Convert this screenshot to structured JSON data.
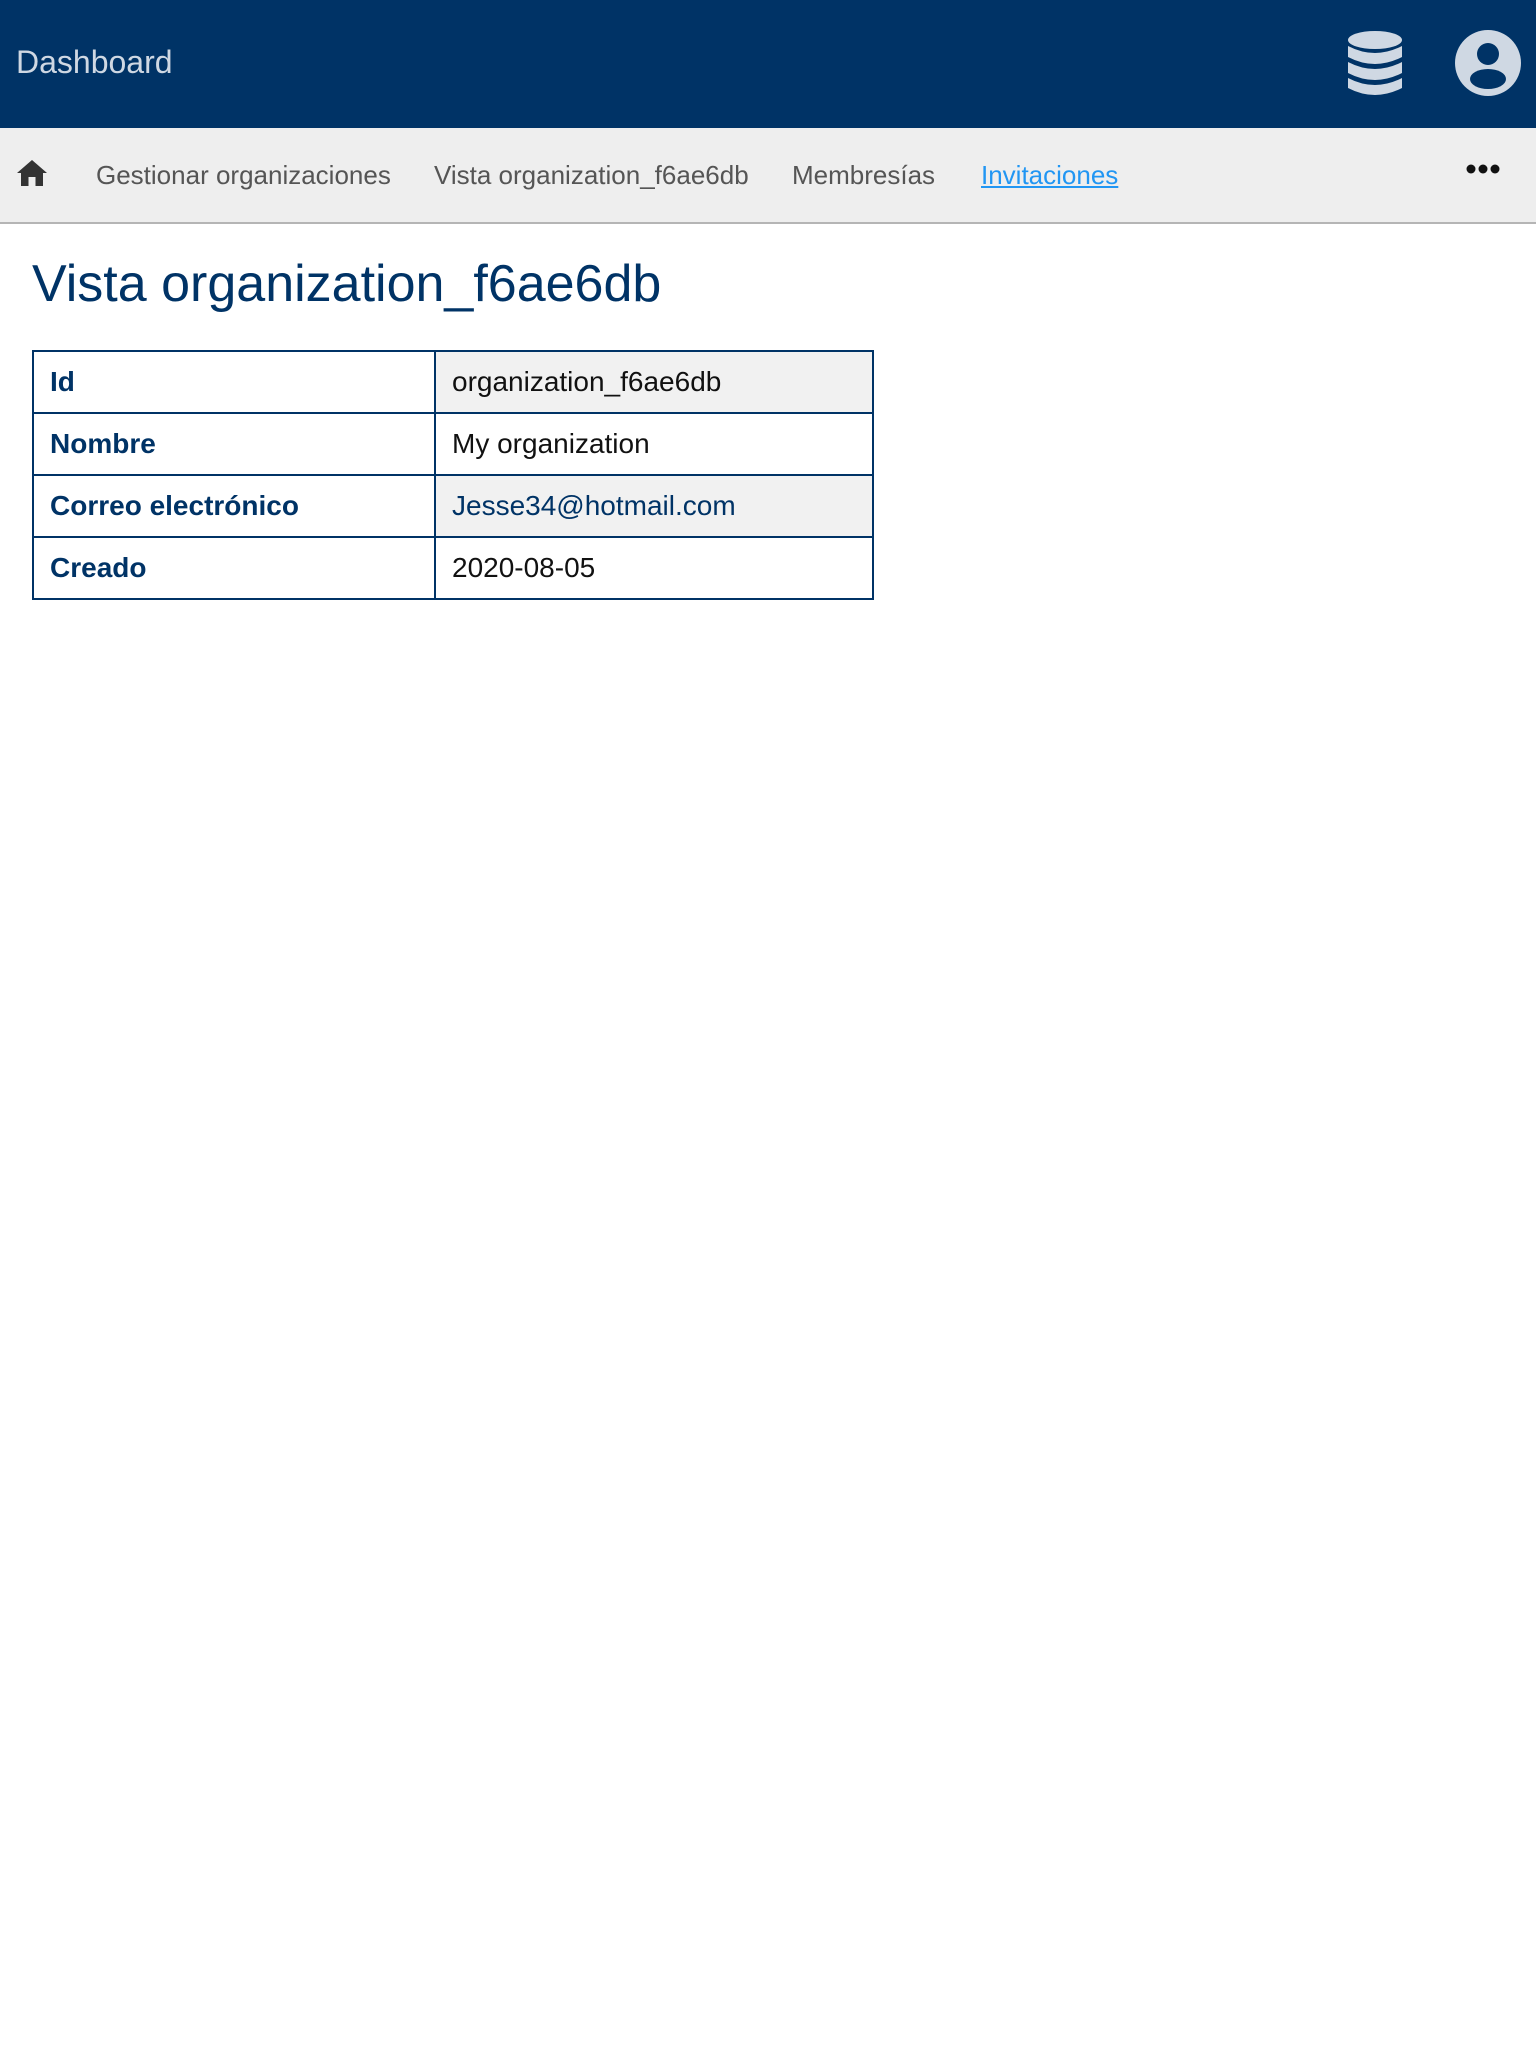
{
  "header": {
    "title": "Dashboard",
    "icons": [
      "database-icon",
      "user-account-icon"
    ],
    "background_color": "#003366"
  },
  "nav": {
    "home_icon": "home-icon",
    "items": [
      {
        "label": "Gestionar organizaciones",
        "active": false
      },
      {
        "label": "Vista organization_f6ae6db",
        "active": false
      },
      {
        "label": "Membresías",
        "active": false
      },
      {
        "label": "Invitaciones",
        "active": true
      }
    ],
    "more_icon": "more-horizontal-icon",
    "active_color": "#2196f3"
  },
  "page": {
    "title": "Vista organization_f6ae6db"
  },
  "details": {
    "rows": [
      {
        "label": "Id",
        "value": "organization_f6ae6db"
      },
      {
        "label": "Nombre",
        "value": "My organization"
      },
      {
        "label": "Correo electrónico",
        "value": "Jesse34@hotmail.com"
      },
      {
        "label": "Creado",
        "value": "2020-08-05"
      }
    ]
  }
}
